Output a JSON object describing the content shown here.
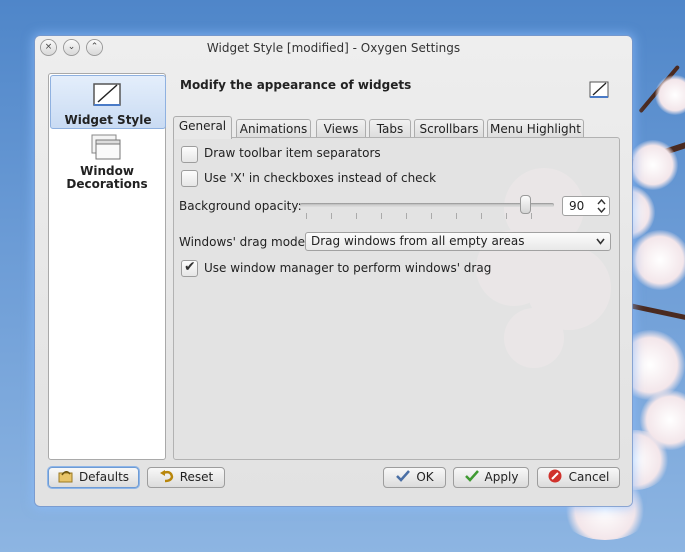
{
  "window": {
    "title": "Widget Style [modified] - Oxygen Settings"
  },
  "titlebar_buttons": {
    "close": "×",
    "minimize": "⌄",
    "maximize": "⌃"
  },
  "sidebar": {
    "items": [
      {
        "label": "Widget Style",
        "icon": "widget-style-icon",
        "selected": true
      },
      {
        "label_line1": "Window",
        "label_line2": "Decorations",
        "icon": "window-decorations-icon",
        "selected": false
      }
    ]
  },
  "header": {
    "title": "Modify the appearance of widgets",
    "icon": "widget-style-icon"
  },
  "tabs": [
    {
      "label": "General",
      "active": true
    },
    {
      "label": "Animations",
      "active": false
    },
    {
      "label": "Views",
      "active": false
    },
    {
      "label": "Tabs",
      "active": false
    },
    {
      "label": "Scrollbars",
      "active": false
    },
    {
      "label": "Menu Highlight",
      "active": false
    }
  ],
  "general": {
    "toolbar_separators": {
      "label": "Draw toolbar item separators",
      "checked": false
    },
    "x_checkboxes": {
      "label": "Use 'X' in checkboxes instead of check",
      "checked": false
    },
    "background_opacity": {
      "label": "Background opacity:",
      "value": "90",
      "slider_fraction": 0.9
    },
    "drag_mode": {
      "label": "Windows' drag mode:",
      "value": "Drag windows from all empty areas"
    },
    "wm_drag": {
      "label": "Use window manager to perform windows' drag",
      "checked": true,
      "check_glyph": "✔"
    }
  },
  "buttons": {
    "defaults": "Defaults",
    "reset": "Reset",
    "ok": "OK",
    "apply": "Apply",
    "cancel": "Cancel"
  },
  "colors": {
    "selection": "#c9dbf3",
    "focus": "#6d9bd5",
    "ok_icon": "#4a6fa5",
    "apply_icon": "#3f9a32",
    "cancel_icon": "#d0322c"
  }
}
